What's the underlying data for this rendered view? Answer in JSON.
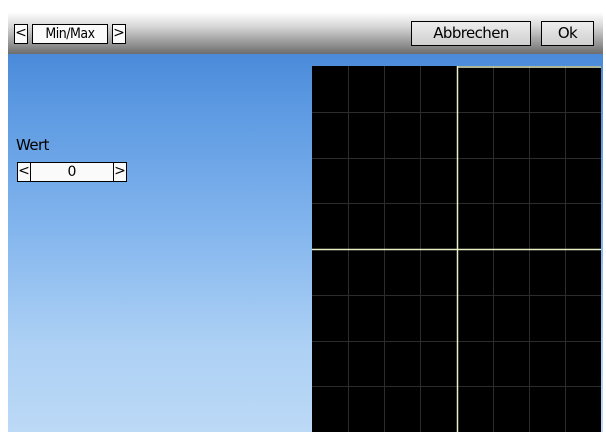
{
  "header": {
    "mode_prev_glyph": "<",
    "mode_label": "Min/Max",
    "mode_next_glyph": ">",
    "cancel_label": "Abbrechen",
    "ok_label": "Ok"
  },
  "left_panel": {
    "value_label": "Wert",
    "value": "0",
    "decrement_glyph": "<",
    "increment_glyph": ">"
  },
  "curve_panel": {
    "background_color": "#000000",
    "grid_color": "#2c2c2c",
    "axis_color": "#e8f0c8",
    "grid_columns": 8,
    "grid_rows": 8
  }
}
